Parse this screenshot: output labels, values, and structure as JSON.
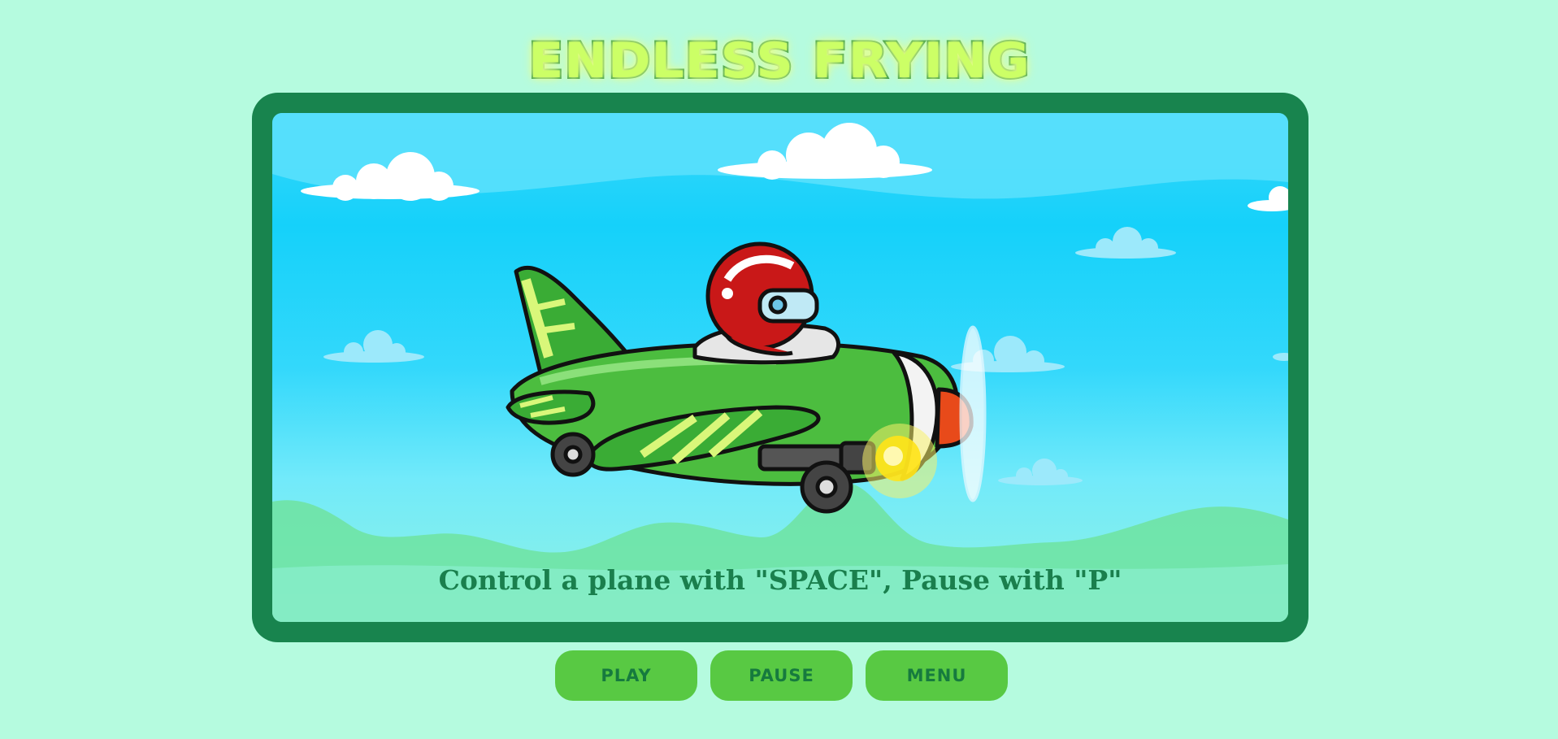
{
  "game": {
    "title": "ENDLESS FRYING",
    "instructions": "Control a plane with \"SPACE\", Pause with \"P\""
  },
  "buttons": {
    "play": "PLAY",
    "pause": "PAUSE",
    "menu": "MENU"
  },
  "colors": {
    "page_background": "#b5fbdf",
    "frame": "#18844e",
    "sky": "#15d1fa",
    "title_fill": "#ccff66",
    "title_stroke": "#1a8a3a",
    "button": "#58c943",
    "button_text": "#167a3e",
    "instruction_text": "#1a7f4d"
  }
}
